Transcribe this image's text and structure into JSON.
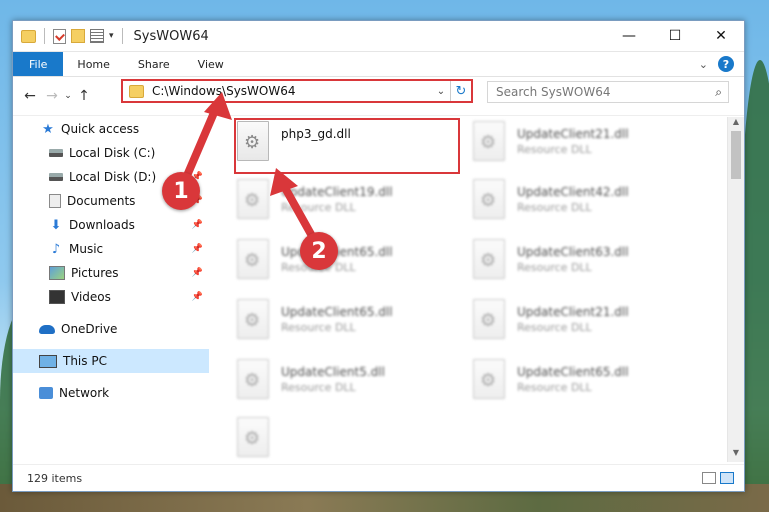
{
  "window": {
    "title": "SysWOW64",
    "controls": {
      "minimize": "—",
      "maximize": "☐",
      "close": "✕"
    }
  },
  "quick_access_toolbar": {
    "dropdown": "▾"
  },
  "ribbon": {
    "tabs": [
      "File",
      "Home",
      "Share",
      "View"
    ],
    "collapse": "⌄",
    "help": "?"
  },
  "navigation": {
    "back": "←",
    "forward": "→",
    "recent": "⌄",
    "up": "↑"
  },
  "address_bar": {
    "path": "C:\\Windows\\SysWOW64",
    "dropdown": "⌄",
    "refresh": "↻"
  },
  "search": {
    "placeholder": "Search SysWOW64",
    "icon": "⌕"
  },
  "sidebar": {
    "items": [
      {
        "label": "Quick access",
        "icon": "star-icon"
      },
      {
        "label": "Local Disk (C:)",
        "icon": "drive-icon"
      },
      {
        "label": "Local Disk (D:)",
        "icon": "drive-icon",
        "pinned": true
      },
      {
        "label": "Documents",
        "icon": "documents-icon",
        "pinned": true
      },
      {
        "label": "Downloads",
        "icon": "downloads-icon",
        "pinned": true
      },
      {
        "label": "Music",
        "icon": "music-icon",
        "pinned": true
      },
      {
        "label": "Pictures",
        "icon": "pictures-icon",
        "pinned": true
      },
      {
        "label": "Videos",
        "icon": "videos-icon",
        "pinned": true
      },
      {
        "label": "OneDrive",
        "icon": "onedrive-icon"
      },
      {
        "label": "This PC",
        "icon": "this-pc-icon",
        "selected": true
      },
      {
        "label": "Network",
        "icon": "network-icon"
      }
    ]
  },
  "files": {
    "highlighted": {
      "name": "php3_gd.dll"
    },
    "others": [
      {
        "name": "UpdateClient21.dll",
        "desc": "Resource DLL"
      },
      {
        "name": "UpdateClient19.dll",
        "desc": "Resource DLL"
      },
      {
        "name": "UpdateClient42.dll",
        "desc": "Resource DLL"
      },
      {
        "name": "UpdateClient65.dll",
        "desc": "Resource DLL"
      },
      {
        "name": "UpdateClient63.dll",
        "desc": "Resource DLL"
      },
      {
        "name": "UpdateClient65.dll",
        "desc": "Resource DLL"
      },
      {
        "name": "UpdateClient21.dll",
        "desc": "Resource DLL"
      },
      {
        "name": "UpdateClient5.dll",
        "desc": "Resource DLL"
      },
      {
        "name": "UpdateClient65.dll",
        "desc": "Resource DLL"
      }
    ]
  },
  "status": {
    "item_count": "129 items"
  },
  "annotations": {
    "badge_1": "1",
    "badge_2": "2",
    "color": "#d9373a"
  },
  "colors": {
    "accent": "#1979ca",
    "highlight": "#d9373a",
    "selection": "#cce8ff"
  }
}
